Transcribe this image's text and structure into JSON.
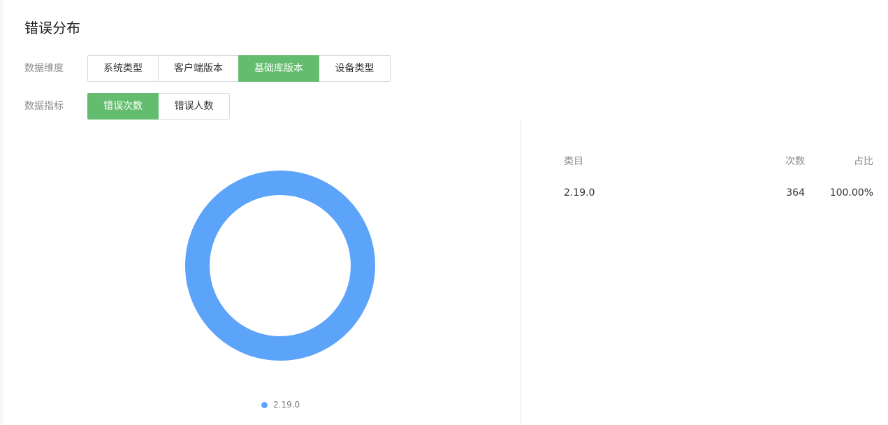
{
  "title": "错误分布",
  "filters": {
    "dimension": {
      "label": "数据维度",
      "options": [
        "系统类型",
        "客户端版本",
        "基础库版本",
        "设备类型"
      ],
      "selected": "基础库版本"
    },
    "metric": {
      "label": "数据指标",
      "options": [
        "错误次数",
        "错误人数"
      ],
      "selected": "错误次数"
    }
  },
  "chart_data": {
    "type": "pie",
    "categories": [
      "2.19.0"
    ],
    "values": [
      364
    ],
    "colors": [
      "#5ca3fa"
    ],
    "legend_position": "bottom"
  },
  "table": {
    "headers": [
      "类目",
      "次数",
      "占比"
    ],
    "rows": [
      [
        "2.19.0",
        "364",
        "100.00%"
      ]
    ]
  },
  "colors": {
    "accent": "#64bd6e",
    "series": "#5ca3fa"
  }
}
